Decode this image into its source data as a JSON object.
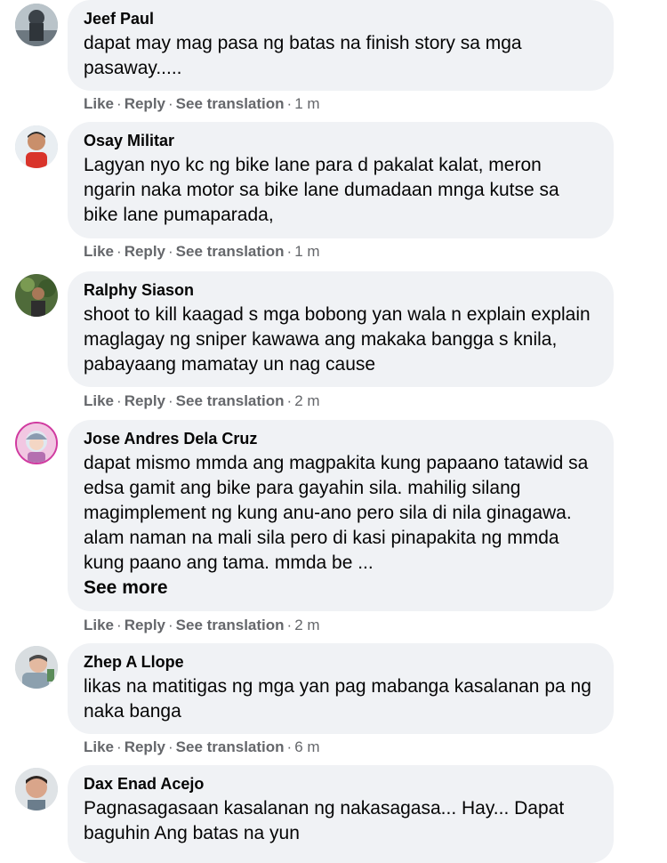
{
  "comments": [
    {
      "author": "Jeef Paul",
      "text": "dapat may mag pasa ng batas na finish story sa mga pasaway.....",
      "time": "1 m"
    },
    {
      "author": "Osay Militar",
      "text": "Lagyan nyo kc ng bike lane para d pakalat kalat, meron ngarin naka motor sa bike lane dumadaan mnga kutse sa bike lane pumaparada,",
      "time": "1 m"
    },
    {
      "author": "Ralphy Siason",
      "text": "shoot to kill kaagad s mga bobong yan wala n explain explain maglagay ng sniper kawawa ang makaka bangga s knila, pabayaang mamatay un nag cause",
      "time": "2 m"
    },
    {
      "author": "Jose Andres Dela Cruz",
      "text": "dapat mismo mmda ang magpakita kung papaano tatawid sa edsa gamit ang bike para gayahin sila. mahilig silang magimplement ng kung anu-ano pero sila di nila ginagawa. alam naman na mali sila pero di kasi pinapakita ng mmda kung paano ang tama. mmda be ...",
      "see_more": "See more",
      "time": "2 m"
    },
    {
      "author": "Zhep A Llope",
      "text": "likas na matitigas ng mga yan pag mabanga kasalanan pa ng naka banga",
      "time": "6 m"
    },
    {
      "author": "Dax Enad Acejo",
      "text": "Pagnasagasaan kasalanan ng nakasagasa... Hay... Dapat baguhin Ang batas na yun"
    }
  ],
  "actions": {
    "like": "Like",
    "reply": "Reply",
    "see_translation": "See translation",
    "separator": "·"
  }
}
